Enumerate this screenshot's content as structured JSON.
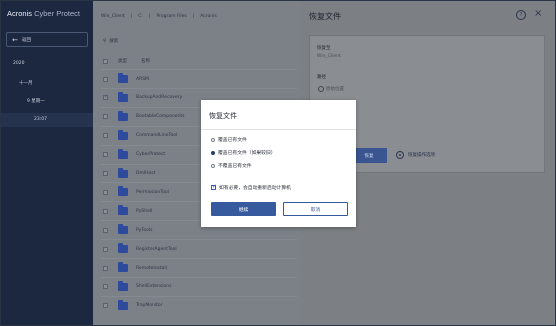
{
  "app": {
    "brand_strong": "Acronis",
    "brand_light": " Cyber Protect"
  },
  "sidebar": {
    "back_label": "返回",
    "tree": [
      {
        "label": "2020"
      },
      {
        "label": "十一月"
      },
      {
        "label": "9 星期一"
      },
      {
        "label": "23:07"
      }
    ]
  },
  "file_list": {
    "breadcrumbs": [
      "Win_Client",
      "C:",
      "Program Files",
      "Acronis"
    ],
    "search_placeholder": "搜索",
    "columns": {
      "type": "类型",
      "name": "名称"
    },
    "rows": [
      {
        "name": "ARSM",
        "checked": false
      },
      {
        "name": "BackupAndRecovery",
        "checked": true
      },
      {
        "name": "BootableComponents",
        "checked": false
      },
      {
        "name": "CommandLineTool",
        "checked": false
      },
      {
        "name": "CyberProtect",
        "checked": false
      },
      {
        "name": "DmlHost",
        "checked": false
      },
      {
        "name": "PermissionTool",
        "checked": false
      },
      {
        "name": "PyShell",
        "checked": false
      },
      {
        "name": "PyTools",
        "checked": false
      },
      {
        "name": "RegisterAgentTool",
        "checked": false
      },
      {
        "name": "RemoteInstall",
        "checked": false
      },
      {
        "name": "ShellExtensions",
        "checked": false
      },
      {
        "name": "TrayMonitor",
        "checked": false
      }
    ]
  },
  "panel": {
    "title": "恢复文件",
    "recover_to_label": "恢复至",
    "recover_to_value": "Win_Client",
    "path_label": "路径",
    "path_option": "原始位置",
    "recover_button": "恢复",
    "options_link": "恢复操作选项"
  },
  "modal": {
    "title": "恢复文件",
    "options": [
      {
        "label": "覆盖已有文件",
        "selected": false
      },
      {
        "label": "覆盖已有文件（如果较旧）",
        "selected": true
      },
      {
        "label": "不覆盖已有文件",
        "selected": false
      }
    ],
    "reboot_checkbox": "如有必要，会自动重新启动计算机",
    "primary_button": "继续",
    "secondary_button": "取消"
  },
  "colors": {
    "accent": "#375a9e",
    "sidebar_bg": "#1c2740",
    "panel_bg": "#7c7f83"
  }
}
